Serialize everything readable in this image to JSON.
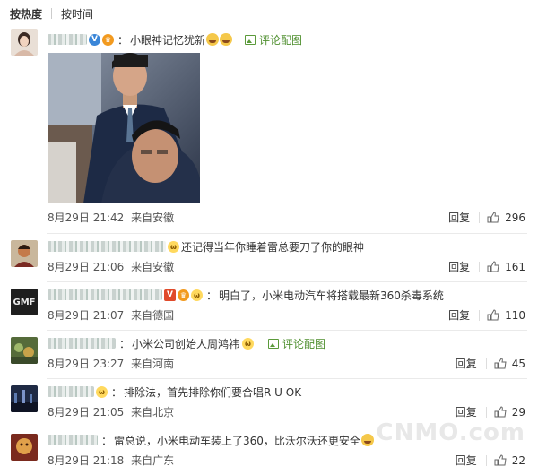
{
  "sort": {
    "hot": "按热度",
    "time": "按时间"
  },
  "watermark": "CNMO.com",
  "common": {
    "reply": "回复",
    "pic_comment": "评论配图"
  },
  "comments": [
    {
      "text": "小眼神记忆犹新",
      "time": "8月29日 21:42",
      "from": "来自安徽",
      "likes": "296"
    },
    {
      "text": "还记得当年你睡着雷总要刀了你的眼神",
      "time": "8月29日 21:06",
      "from": "来自安徽",
      "likes": "161"
    },
    {
      "text": "明白了，小米电动汽车将搭载最新360杀毒系统",
      "time": "8月29日 21:07",
      "from": "来自德国",
      "likes": "110",
      "avatar_text": "GMF"
    },
    {
      "text": "小米公司创始人周鸿祎",
      "time": "8月29日 23:27",
      "from": "来自河南",
      "likes": "45"
    },
    {
      "text": "排除法，首先排除你们要合唱R U OK",
      "time": "8月29日 21:05",
      "from": "来自北京",
      "likes": "29"
    },
    {
      "text": "雷总说，小米电动车装上了360，比沃尔沃还更安全",
      "time": "8月29日 21:18",
      "from": "来自广东",
      "likes": "22"
    }
  ]
}
